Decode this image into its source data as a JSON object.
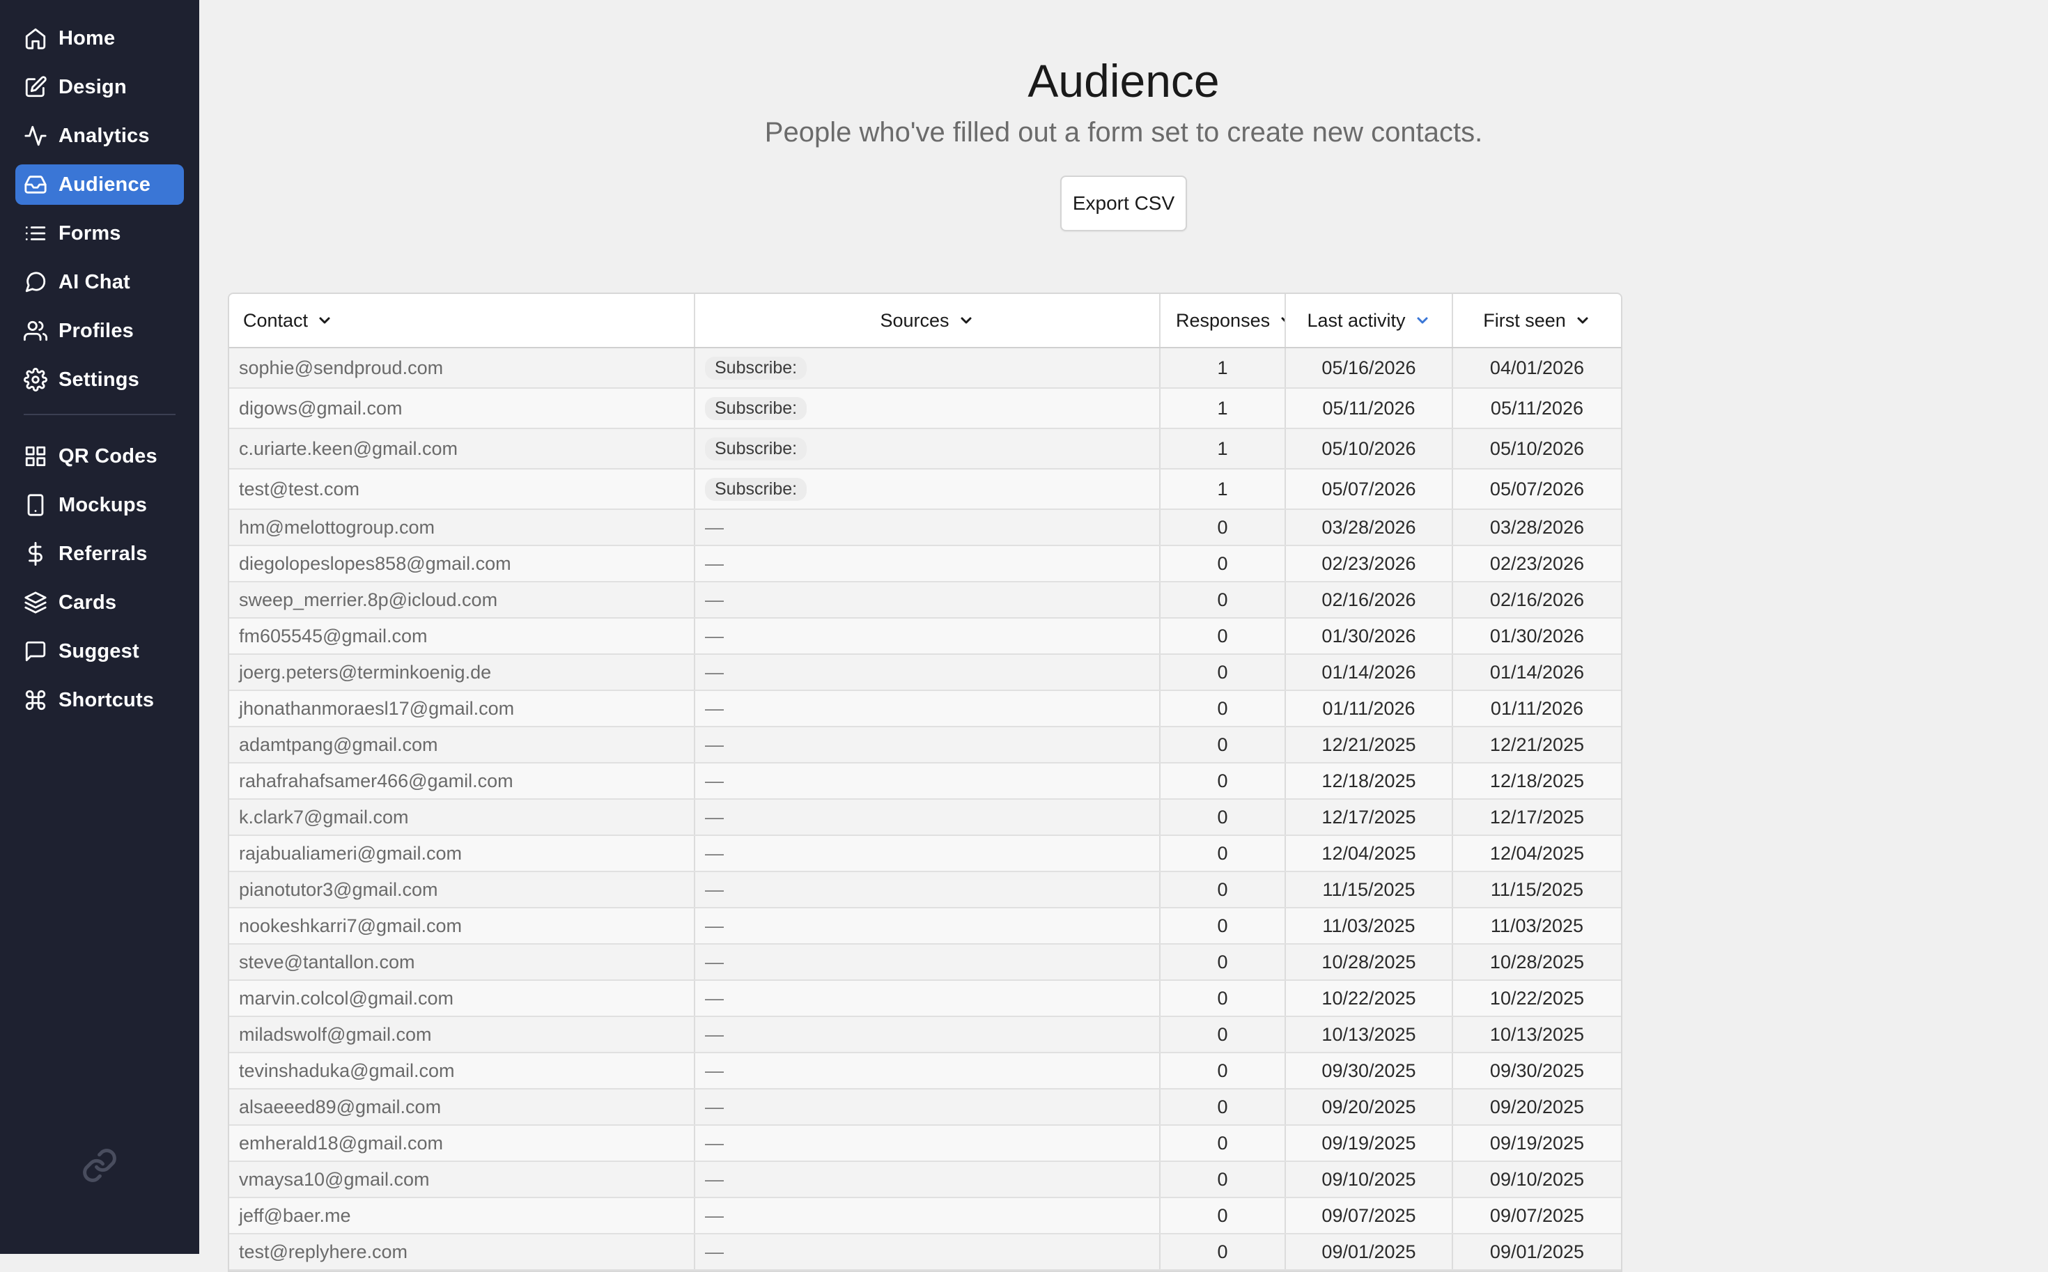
{
  "sidebar": {
    "items": [
      {
        "label": "Home",
        "icon": "home-icon"
      },
      {
        "label": "Design",
        "icon": "edit-icon"
      },
      {
        "label": "Analytics",
        "icon": "activity-icon"
      },
      {
        "label": "Audience",
        "icon": "inbox-icon",
        "active": true
      },
      {
        "label": "Forms",
        "icon": "list-icon"
      },
      {
        "label": "AI Chat",
        "icon": "chat-bubble-icon"
      },
      {
        "label": "Profiles",
        "icon": "users-icon"
      },
      {
        "label": "Settings",
        "icon": "gear-icon"
      }
    ],
    "secondary_items": [
      {
        "label": "QR Codes",
        "icon": "grid-icon"
      },
      {
        "label": "Mockups",
        "icon": "phone-icon"
      },
      {
        "label": "Referrals",
        "icon": "dollar-icon"
      },
      {
        "label": "Cards",
        "icon": "layers-icon"
      },
      {
        "label": "Suggest",
        "icon": "message-square-icon"
      },
      {
        "label": "Shortcuts",
        "icon": "command-icon"
      }
    ],
    "logo_icon": "link-logo-icon"
  },
  "header": {
    "title": "Audience",
    "subtitle": "People who've filled out a form set to create new contacts.",
    "export_label": "Export CSV"
  },
  "table": {
    "columns": {
      "contact": "Contact",
      "sources": "Sources",
      "responses": "Responses",
      "last_activity": "Last activity",
      "first_seen": "First seen"
    },
    "rows": [
      {
        "contact": "sophie@sendproud.com",
        "source": "Subscribe:",
        "responses": "1",
        "last": "05/16/2026",
        "first": "04/01/2026"
      },
      {
        "contact": "digows@gmail.com",
        "source": "Subscribe:",
        "responses": "1",
        "last": "05/11/2026",
        "first": "05/11/2026"
      },
      {
        "contact": "c.uriarte.keen@gmail.com",
        "source": "Subscribe:",
        "responses": "1",
        "last": "05/10/2026",
        "first": "05/10/2026"
      },
      {
        "contact": "test@test.com",
        "source": "Subscribe:",
        "responses": "1",
        "last": "05/07/2026",
        "first": "05/07/2026"
      },
      {
        "contact": "hm@melottogroup.com",
        "source": "—",
        "responses": "0",
        "last": "03/28/2026",
        "first": "03/28/2026"
      },
      {
        "contact": "diegolopeslopes858@gmail.com",
        "source": "—",
        "responses": "0",
        "last": "02/23/2026",
        "first": "02/23/2026"
      },
      {
        "contact": "sweep_merrier.8p@icloud.com",
        "source": "—",
        "responses": "0",
        "last": "02/16/2026",
        "first": "02/16/2026"
      },
      {
        "contact": "fm605545@gmail.com",
        "source": "—",
        "responses": "0",
        "last": "01/30/2026",
        "first": "01/30/2026"
      },
      {
        "contact": "joerg.peters@terminkoenig.de",
        "source": "—",
        "responses": "0",
        "last": "01/14/2026",
        "first": "01/14/2026"
      },
      {
        "contact": "jhonathanmoraesl17@gmail.com",
        "source": "—",
        "responses": "0",
        "last": "01/11/2026",
        "first": "01/11/2026"
      },
      {
        "contact": "adamtpang@gmail.com",
        "source": "—",
        "responses": "0",
        "last": "12/21/2025",
        "first": "12/21/2025"
      },
      {
        "contact": "rahafrahafsamer466@gamil.com",
        "source": "—",
        "responses": "0",
        "last": "12/18/2025",
        "first": "12/18/2025"
      },
      {
        "contact": "k.clark7@gmail.com",
        "source": "—",
        "responses": "0",
        "last": "12/17/2025",
        "first": "12/17/2025"
      },
      {
        "contact": "rajabualiameri@gmail.com",
        "source": "—",
        "responses": "0",
        "last": "12/04/2025",
        "first": "12/04/2025"
      },
      {
        "contact": "pianotutor3@gmail.com",
        "source": "—",
        "responses": "0",
        "last": "11/15/2025",
        "first": "11/15/2025"
      },
      {
        "contact": "nookeshkarri7@gmail.com",
        "source": "—",
        "responses": "0",
        "last": "11/03/2025",
        "first": "11/03/2025"
      },
      {
        "contact": "steve@tantallon.com",
        "source": "—",
        "responses": "0",
        "last": "10/28/2025",
        "first": "10/28/2025"
      },
      {
        "contact": "marvin.colcol@gmail.com",
        "source": "—",
        "responses": "0",
        "last": "10/22/2025",
        "first": "10/22/2025"
      },
      {
        "contact": "miladswolf@gmail.com",
        "source": "—",
        "responses": "0",
        "last": "10/13/2025",
        "first": "10/13/2025"
      },
      {
        "contact": "tevinshaduka@gmail.com",
        "source": "—",
        "responses": "0",
        "last": "09/30/2025",
        "first": "09/30/2025"
      },
      {
        "contact": "alsaeeed89@gmail.com",
        "source": "—",
        "responses": "0",
        "last": "09/20/2025",
        "first": "09/20/2025"
      },
      {
        "contact": "emherald18@gmail.com",
        "source": "—",
        "responses": "0",
        "last": "09/19/2025",
        "first": "09/19/2025"
      },
      {
        "contact": "vmaysa10@gmail.com",
        "source": "—",
        "responses": "0",
        "last": "09/10/2025",
        "first": "09/10/2025"
      },
      {
        "contact": "jeff@baer.me",
        "source": "—",
        "responses": "0",
        "last": "09/07/2025",
        "first": "09/07/2025"
      },
      {
        "contact": "test@replyhere.com",
        "source": "—",
        "responses": "0",
        "last": "09/01/2025",
        "first": "09/01/2025"
      }
    ]
  },
  "colors": {
    "sidebar_bg": "#1e2130",
    "active_item": "#3a76d6",
    "sort_active": "#3a76d6"
  }
}
